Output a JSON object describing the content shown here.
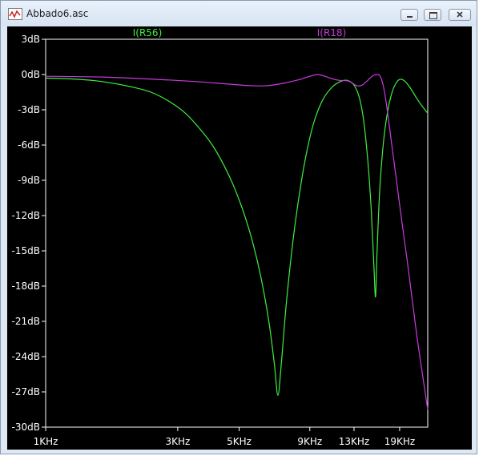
{
  "window": {
    "title": "Abbado6.asc"
  },
  "icons": {
    "app": "waveform-app-icon",
    "minimize": "minimize-icon",
    "maximize": "maximize-icon",
    "close": "close-icon"
  },
  "colors": {
    "background": "#000000",
    "axis": "#ffffff",
    "series_1": "#3ff03f",
    "series_2": "#c83cdc"
  },
  "chart_data": {
    "type": "line",
    "title": "",
    "xlabel": "",
    "ylabel": "",
    "x_scale": "log",
    "xlim": [
      1000,
      24000
    ],
    "ylim": [
      -30,
      3
    ],
    "grid": false,
    "legend_placement": "top",
    "x_ticks": [
      {
        "value": 1000,
        "label": "1KHz"
      },
      {
        "value": 3000,
        "label": "3KHz"
      },
      {
        "value": 5000,
        "label": "5KHz"
      },
      {
        "value": 9000,
        "label": "9KHz"
      },
      {
        "value": 13000,
        "label": "13KHz"
      },
      {
        "value": 19000,
        "label": "19KHz"
      }
    ],
    "y_ticks": [
      {
        "value": 3,
        "label": "3dB"
      },
      {
        "value": 0,
        "label": "0dB"
      },
      {
        "value": -3,
        "label": "-3dB"
      },
      {
        "value": -6,
        "label": "-6dB"
      },
      {
        "value": -9,
        "label": "-9dB"
      },
      {
        "value": -12,
        "label": "-12dB"
      },
      {
        "value": -15,
        "label": "-15dB"
      },
      {
        "value": -18,
        "label": "-18dB"
      },
      {
        "value": -21,
        "label": "-21dB"
      },
      {
        "value": -24,
        "label": "-24dB"
      },
      {
        "value": -27,
        "label": "-27dB"
      },
      {
        "value": -30,
        "label": "-30dB"
      }
    ],
    "series": [
      {
        "name": "I(R56)",
        "color": "#3ff03f",
        "points": [
          [
            1000,
            -0.3
          ],
          [
            1300,
            -0.4
          ],
          [
            1600,
            -0.6
          ],
          [
            2000,
            -1.0
          ],
          [
            2400,
            -1.5
          ],
          [
            2800,
            -2.3
          ],
          [
            3200,
            -3.3
          ],
          [
            3600,
            -4.6
          ],
          [
            4000,
            -6.0
          ],
          [
            4400,
            -7.7
          ],
          [
            4800,
            -9.6
          ],
          [
            5200,
            -11.8
          ],
          [
            5600,
            -14.3
          ],
          [
            6000,
            -17.3
          ],
          [
            6400,
            -21.0
          ],
          [
            6700,
            -24.6
          ],
          [
            6900,
            -27.3
          ],
          [
            7100,
            -24.6
          ],
          [
            7400,
            -19.5
          ],
          [
            7800,
            -14.4
          ],
          [
            8200,
            -10.6
          ],
          [
            8700,
            -7.0
          ],
          [
            9300,
            -4.1
          ],
          [
            10000,
            -2.2
          ],
          [
            10800,
            -1.1
          ],
          [
            11600,
            -0.6
          ],
          [
            12300,
            -0.5
          ],
          [
            13000,
            -0.9
          ],
          [
            13600,
            -2.0
          ],
          [
            14100,
            -4.0
          ],
          [
            14600,
            -7.5
          ],
          [
            15000,
            -11.5
          ],
          [
            15350,
            -16.5
          ],
          [
            15550,
            -18.9
          ],
          [
            15750,
            -15.0
          ],
          [
            16100,
            -9.8
          ],
          [
            16600,
            -5.8
          ],
          [
            17200,
            -3.1
          ],
          [
            17900,
            -1.4
          ],
          [
            18600,
            -0.6
          ],
          [
            19200,
            -0.4
          ],
          [
            19900,
            -0.6
          ],
          [
            20700,
            -1.1
          ],
          [
            21600,
            -1.8
          ],
          [
            22600,
            -2.5
          ],
          [
            24000,
            -3.3
          ]
        ]
      },
      {
        "name": "I(R18)",
        "color": "#c83cdc",
        "points": [
          [
            1000,
            -0.15
          ],
          [
            1500,
            -0.2
          ],
          [
            2000,
            -0.3
          ],
          [
            2700,
            -0.45
          ],
          [
            3500,
            -0.6
          ],
          [
            4500,
            -0.8
          ],
          [
            5500,
            -0.95
          ],
          [
            6300,
            -0.95
          ],
          [
            7200,
            -0.75
          ],
          [
            8200,
            -0.45
          ],
          [
            9000,
            -0.15
          ],
          [
            9600,
            0.0
          ],
          [
            10200,
            -0.15
          ],
          [
            10800,
            -0.35
          ],
          [
            11500,
            -0.5
          ],
          [
            12400,
            -0.55
          ],
          [
            13300,
            -0.95
          ],
          [
            13900,
            -0.9
          ],
          [
            14500,
            -0.55
          ],
          [
            15100,
            -0.15
          ],
          [
            15700,
            0.0
          ],
          [
            16200,
            -0.2
          ],
          [
            16700,
            -1.3
          ],
          [
            17200,
            -3.3
          ],
          [
            17800,
            -6.0
          ],
          [
            18500,
            -9.0
          ],
          [
            19300,
            -12.3
          ],
          [
            20200,
            -15.7
          ],
          [
            21100,
            -19.2
          ],
          [
            22000,
            -22.5
          ],
          [
            23000,
            -25.6
          ],
          [
            24000,
            -28.5
          ]
        ]
      }
    ]
  }
}
